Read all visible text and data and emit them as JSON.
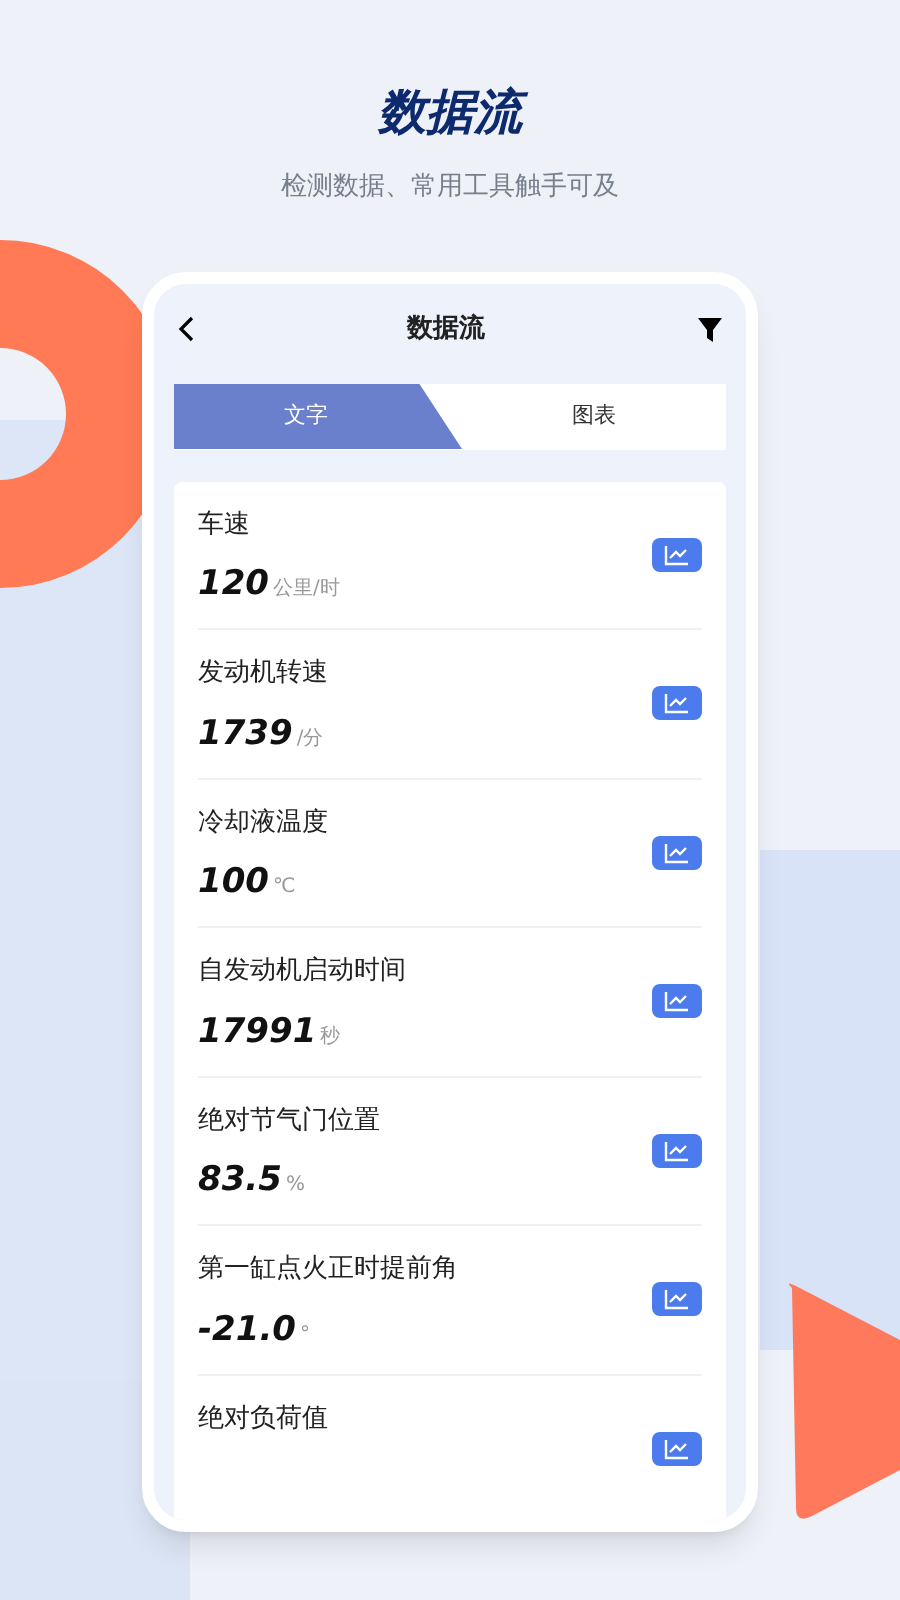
{
  "header": {
    "title": "数据流",
    "subtitle": "检测数据、常用工具触手可及"
  },
  "screen": {
    "title": "数据流",
    "tabs": [
      {
        "label": "文字",
        "selected": true
      },
      {
        "label": "图表",
        "selected": false
      }
    ],
    "items": [
      {
        "name": "车速",
        "value": "120",
        "unit": "公里/时"
      },
      {
        "name": "发动机转速",
        "value": "1739",
        "unit": "/分"
      },
      {
        "name": "冷却液温度",
        "value": "100",
        "unit": "℃"
      },
      {
        "name": "自发动机启动时间",
        "value": "17991",
        "unit": "秒"
      },
      {
        "name": "绝对节气门位置",
        "value": "83.5",
        "unit": "%"
      },
      {
        "name": "第一缸点火正时提前角",
        "value": "-21.0",
        "unit": "°"
      },
      {
        "name": "绝对负荷值"
      }
    ]
  }
}
